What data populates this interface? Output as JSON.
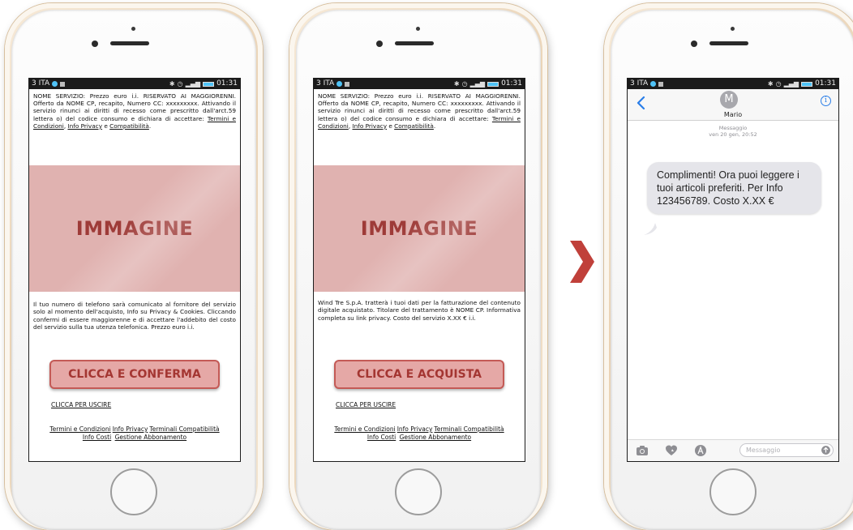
{
  "status_bar": {
    "carrier": "3 ITA",
    "time": "01:31"
  },
  "screen1": {
    "legal_text": "NOME SERVIZIO: Prezzo euro i.i. RISERVATO AI MAGGIORENNI. Offerto da NOME CP, recapito, Numero CC: xxxxxxxxx. Attivando il servizio rinunci ai diritti di recesso come prescritto dall'arct.59 lettera o) del codice consumo e dichiara di accettare: ",
    "link_terms": "Termini e Condizioni",
    "link_privacy": "Info Privacy",
    "conj": " e ",
    "link_compat": "Compatibilità",
    "image_label": "IMMAGINE",
    "body_text": "Il tuo numero di telefono sarà comunicato al fornitore del servizio solo al momento dell'acquisto, Info su Privacy & Cookies. Cliccando confermi di essere maggiorenne e di accettare l'addebito del costo del servizio sulla tua utenza telefonica. Prezzo euro i.i.",
    "cta_label": "CLICCA E CONFERMA",
    "exit_label": "CLICCA PER USCIRE"
  },
  "screen2": {
    "legal_text": "NOME SERVIZIO: Prezzo euro i.i. RISERVATO AI MAGGIORENNI. Offerto da NOME CP, recapito, Numero CC: xxxxxxxxx. Attivando il servizio rinunci ai diritti di recesso come prescritto dall'arct.59 lettera o) del codice consumo e dichiara di accettare: ",
    "link_terms": "Termini e Condizioni",
    "link_privacy": "Info Privacy",
    "conj": " e ",
    "link_compat": "Compatibilità",
    "image_label": "IMMAGINE",
    "body_text": "Wind Tre S.p.A. tratterà i tuoi dati per la fatturazione del contenuto digitale acquistato. Titolare del trattamento è NOME CP. Informativa completa su link privacy. Costo del servizio X.XX € i.i.",
    "cta_label": "CLICCA E ACQUISTA",
    "exit_label": "CLICCA PER USCIRE"
  },
  "footer_links": {
    "terms": "Termini e Condizioni",
    "privacy": "Info Privacy",
    "terminals": "Terminali Compatibilità",
    "costs": "Info Costi",
    "subscription": "Gestione Abbonamento"
  },
  "messages": {
    "avatar_letter": "M",
    "contact_name": "Mario",
    "thread_label": "Messaggio",
    "thread_date": "ven 20 gen, 20:52",
    "message_text": "Complimenti! Ora puoi leggere i tuoi articoli preferiti. Per Info 123456789. Costo X.XX €",
    "input_placeholder": "Messaggio"
  },
  "colors": {
    "cta_fill": "#e5a8a6",
    "cta_border": "#c45a56",
    "cta_text": "#a43632",
    "image_fill": "#e0b2b0",
    "chevron": "#c0403a",
    "ios_blue": "#2a7ee8"
  }
}
